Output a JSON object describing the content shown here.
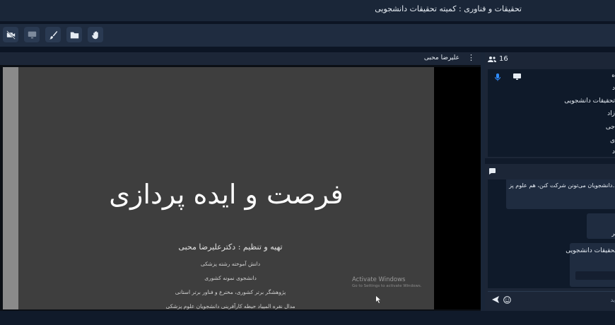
{
  "header": {
    "title": "تحقیقات و فناوری : کمیته تحقیقات دانشجویی"
  },
  "toolbar": {
    "buttons": [
      {
        "name": "raise-hand",
        "icon": "hand-icon"
      },
      {
        "name": "share-file",
        "icon": "folder-icon"
      },
      {
        "name": "whiteboard",
        "icon": "brush-icon"
      },
      {
        "name": "share-screen",
        "icon": "monitor-icon"
      },
      {
        "name": "camera-off",
        "icon": "camera-off-icon"
      }
    ]
  },
  "stage": {
    "presenter": "علیرضا محبی",
    "slide": {
      "title": "فرصت و ایده پردازی",
      "subtitle": "تهیه و تنظیم : دکترعلیرضا محبی",
      "lines": [
        "دانش آموخته رشته پزشکی",
        "دانشجوی نمونه کشوری",
        "پژوهشگر برتر کشوری، مخترع و فناور برتر استانی",
        "مدال نقره المپیاد حیطه کارآفرینی دانشجویان علوم پزشکی"
      ]
    },
    "watermark": {
      "line1": "Activate Windows",
      "line2": "Go to Settings to activate Windows."
    }
  },
  "users": {
    "count": "16",
    "items": [
      "ه",
      "د",
      "تحقیقات دانشجویی",
      "زاد",
      "جی",
      "ی",
      "د"
    ]
  },
  "chat": {
    "messages": [
      {
        "name": "",
        "text": "دانشجویان می‌تونن شرکت کنن، هم علوم پز..."
      },
      {
        "name": "",
        "text": "ير"
      },
      {
        "name": "تحقیقات دانشجویی",
        "text": ""
      }
    ],
    "placeholder": "يد"
  },
  "colors": {
    "background": "#1a2638",
    "panel": "#1c2637",
    "accent": "#2f8cff"
  }
}
